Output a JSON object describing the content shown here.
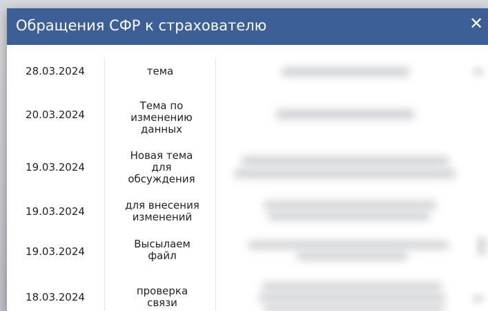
{
  "dialog": {
    "title": "Обращения СФР к страхователю",
    "close_label": "✕"
  },
  "rows": [
    {
      "date": "28.03.2024",
      "topic": "тема"
    },
    {
      "date": "20.03.2024",
      "topic": "Тема по изменению данных"
    },
    {
      "date": "19.03.2024",
      "topic": "Новая тема для обсуждения"
    },
    {
      "date": "19.03.2024",
      "topic": "для внесения изменений"
    },
    {
      "date": "19.03.2024",
      "topic": "Высылаем файл"
    },
    {
      "date": "18.03.2024",
      "topic": "проверка связи"
    }
  ],
  "colors": {
    "header_bg": "#3d5f98",
    "header_text": "#ffffff",
    "body_text": "#222222"
  }
}
